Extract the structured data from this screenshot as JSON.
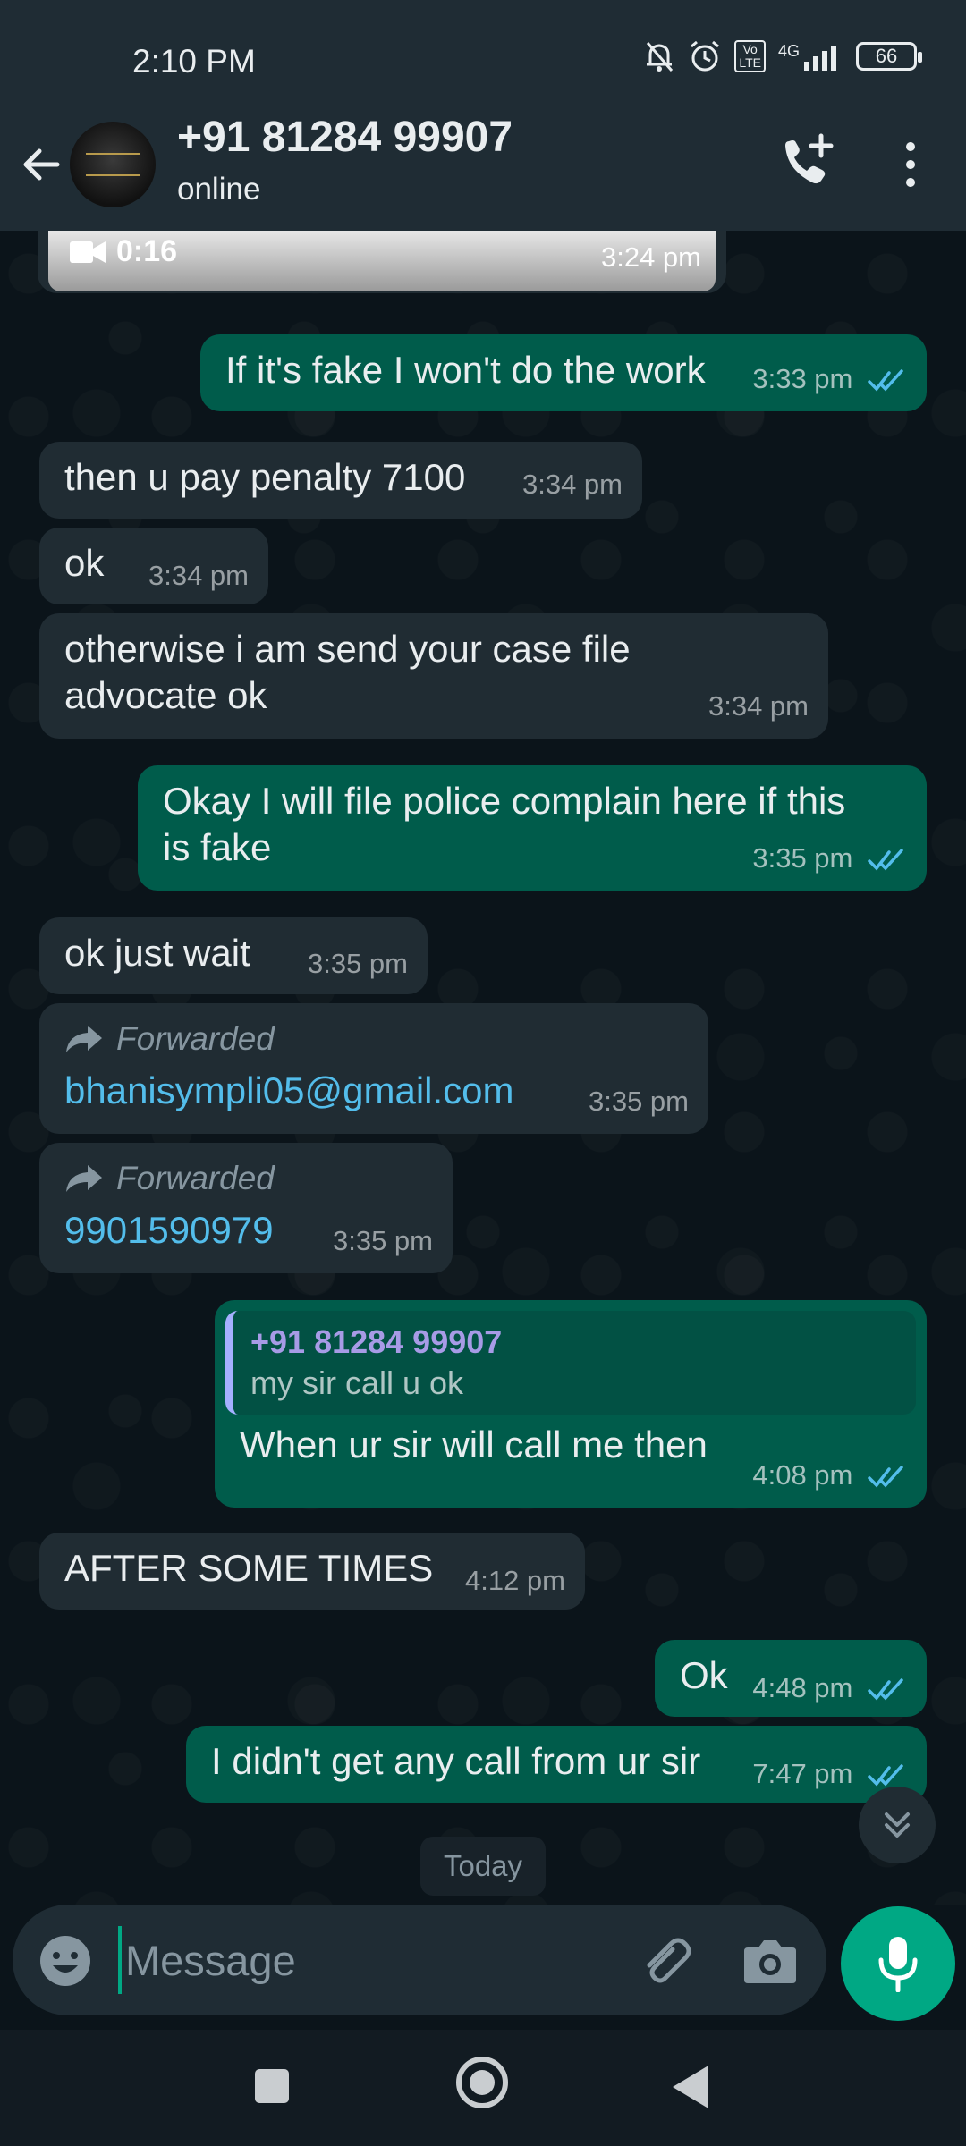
{
  "status_bar": {
    "time": "2:10 PM",
    "network": "4G",
    "volte_line1": "Vo",
    "volte_line2": "LTE",
    "battery": "66",
    "icons": [
      "mute-bell-icon",
      "alarm-icon",
      "volte-icon",
      "signal-icon",
      "battery-icon"
    ]
  },
  "header": {
    "contact_name": "+91 81284 99907",
    "status": "online"
  },
  "messages": {
    "video": {
      "duration": "0:16",
      "time": "3:24 pm"
    },
    "m1": {
      "text": "If it's fake I won't do the work",
      "time": "3:33 pm"
    },
    "m2": {
      "text": "then u pay penalty 7100",
      "time": "3:34 pm"
    },
    "m3": {
      "text": "ok",
      "time": "3:34 pm"
    },
    "m4": {
      "line1": "otherwise i am send your case file",
      "line2": "advocate ok",
      "time": "3:34 pm"
    },
    "m5": {
      "line1": "Okay I will file police complain here if this",
      "line2": "is fake",
      "time": "3:35 pm"
    },
    "m6": {
      "text": "ok just wait",
      "time": "3:35 pm"
    },
    "m7": {
      "forwarded_label": "Forwarded",
      "text": "bhanisympli05@gmail.com",
      "time": "3:35 pm"
    },
    "m8": {
      "forwarded_label": "Forwarded",
      "text": "9901590979",
      "time": "3:35 pm"
    },
    "m9": {
      "quote_name": "+91 81284 99907",
      "quote_text": "my sir call u ok",
      "text": "When ur sir will call me then",
      "time": "4:08 pm"
    },
    "m10": {
      "text": "AFTER SOME TIMES",
      "time": "4:12 pm"
    },
    "m11": {
      "text": "Ok",
      "time": "4:48 pm"
    },
    "m12": {
      "text": "I didn't get any call from ur sir",
      "time": "7:47 pm"
    }
  },
  "date_divider": "Today",
  "composer": {
    "placeholder": "Message"
  },
  "colors": {
    "header_bg": "#1f2c34",
    "chat_bg": "#0b141a",
    "incoming_bubble": "#202c33",
    "outgoing_bubble": "#005c4b",
    "accent": "#00a884",
    "link": "#53bdeb",
    "read_ticks": "#53bdeb"
  }
}
